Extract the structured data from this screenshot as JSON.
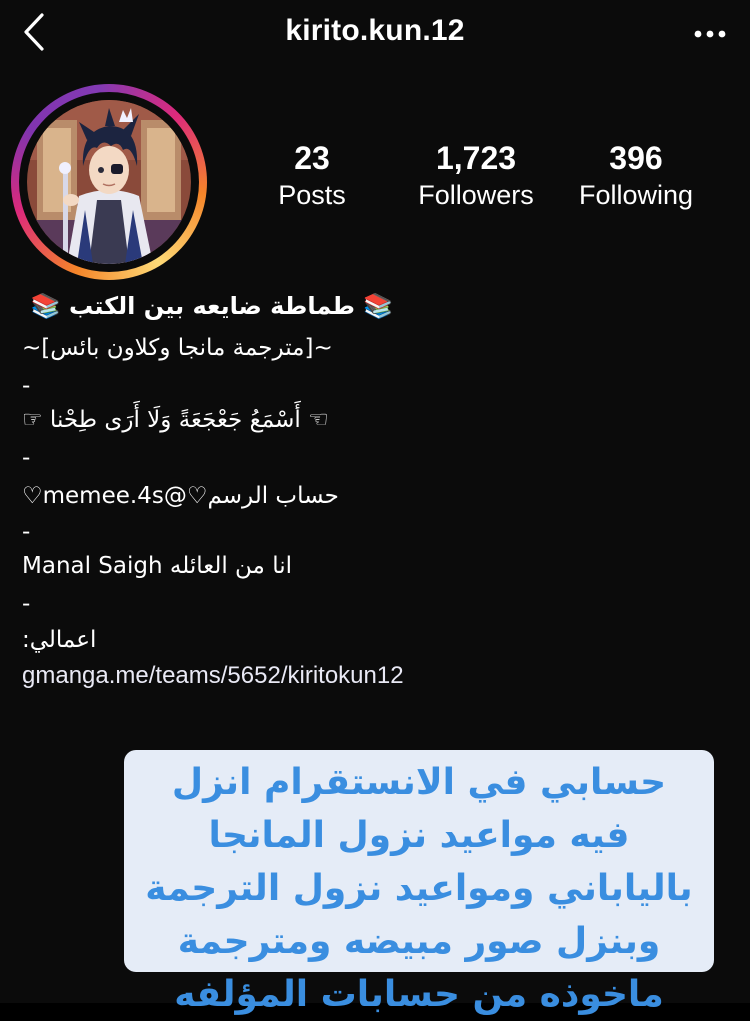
{
  "header": {
    "username": "kirito.kun.12",
    "back_icon": "chevron-left-icon",
    "more_icon": "more-horizontal-icon"
  },
  "profile": {
    "avatar_alt": "profile-avatar",
    "ring_colors": [
      "#f58529",
      "#dd2a7b",
      "#8134af",
      "#feda77"
    ]
  },
  "stats": {
    "posts": {
      "value": "23",
      "label": "Posts"
    },
    "followers": {
      "value": "1,723",
      "label": "Followers"
    },
    "following": {
      "value": "396",
      "label": "Following"
    }
  },
  "bio": {
    "name": "📚 طماطة ضايعه بين الكتب 📚",
    "line1": "~[مترجمة مانجا وكلاون بائس]~",
    "sep1": "-",
    "line2": "☜ أَسْمَعُ جَعْجَعَةً وَلَا أَرَى طِحْنا ☞",
    "sep2": "-",
    "line3": "حساب الرسم♡@memee.4s♡",
    "sep3": "-",
    "line4": "انا من العائله  Manal Saigh",
    "sep4": "-",
    "line5": "اعمالي:",
    "link": "gmanga.me/teams/5652/kiritokun12"
  },
  "caption": {
    "text": "حسابي في الانستقرام انزل فيه مواعيد نزول المانجا بالياباني ومواعيد نزول الترجمة وبنزل صور مبيضه ومترجمة ماخوذه من حسابات المؤلفه",
    "text_color": "#3a8ee0",
    "background": "#e5ecf7"
  }
}
